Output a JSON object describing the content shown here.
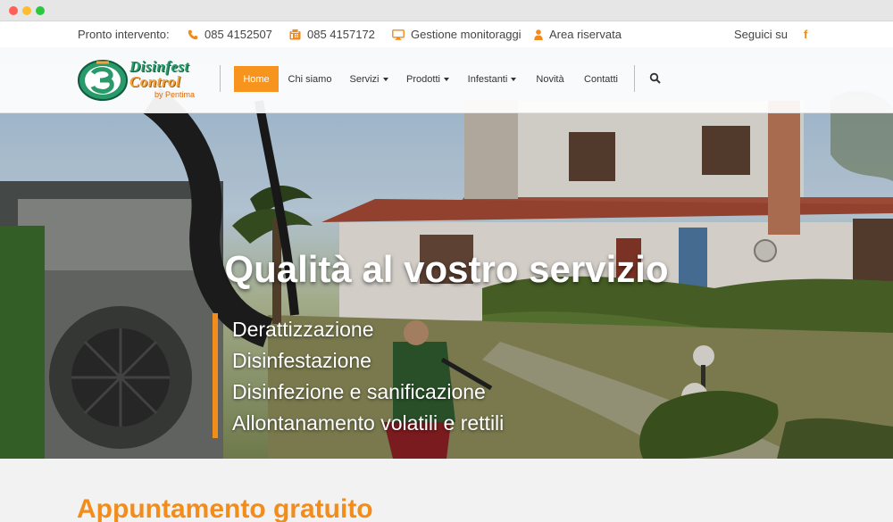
{
  "topbar": {
    "emergency_label": "Pronto intervento:",
    "phone": "085 4152507",
    "fax": "085 4157172",
    "monitoring_label": "Gestione monitoraggi",
    "reserved_label": "Area riservata",
    "social_label": "Seguici su",
    "facebook_glyph": "f"
  },
  "logo": {
    "line1": "Disinfest",
    "line2": "Control",
    "tagline": "by Pentima"
  },
  "nav": {
    "items": [
      {
        "label": "Home",
        "active": true
      },
      {
        "label": "Chi siamo"
      },
      {
        "label": "Servizi",
        "dropdown": true
      },
      {
        "label": "Prodotti",
        "dropdown": true
      },
      {
        "label": "Infestanti",
        "dropdown": true
      },
      {
        "label": "Novità"
      },
      {
        "label": "Contatti"
      }
    ],
    "search_icon": "search-icon"
  },
  "hero": {
    "title": "Qualità al vostro servizio",
    "services": [
      "Derattizzazione",
      "Disinfestazione",
      "Disinfezione e sanificazione",
      "Allontanamento volatili e rettili"
    ]
  },
  "section": {
    "title_light": "Appuntamento",
    "title_bold": "gratuito"
  },
  "colors": {
    "accent": "#f7941d",
    "logo_green": "#2a9a6a"
  }
}
